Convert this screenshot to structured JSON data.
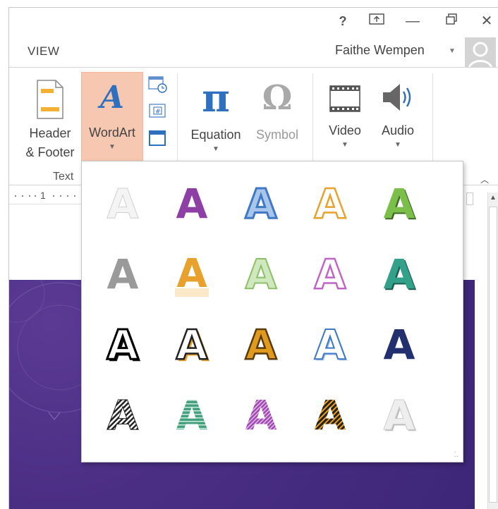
{
  "titlebar": {
    "help_label": "?",
    "minimize_label": "—",
    "close_label": "✕"
  },
  "tabs": {
    "view_label": "VIEW"
  },
  "user": {
    "name": "Faithe Wempen"
  },
  "ribbon": {
    "header_footer_line1": "Header",
    "header_footer_line2": "& Footer",
    "wordart_glyph": "A",
    "wordart_label": "WordArt",
    "equation_glyph": "π",
    "equation_label": "Equation",
    "symbol_glyph": "Ω",
    "symbol_label": "Symbol",
    "video_label": "Video",
    "audio_label": "Audio",
    "group_text": "Text"
  },
  "ruler": {
    "marker": "1"
  },
  "wordart_gallery": {
    "letter": "A",
    "styles": [
      [
        "#f2f2f2",
        "#8e3fa6",
        "#3f78c6",
        "#ffffff",
        "#63a33a"
      ],
      [
        "#9a9a9a",
        "#e7a12c",
        "#a8d08d",
        "#ffffff",
        "#2c8c7a"
      ],
      [
        "#ffffff",
        "#ffffff",
        "#e09a1e",
        "#ffffff",
        "#223070"
      ],
      [
        "#333333",
        "#46a07e",
        "#a04bb0",
        "#222222",
        "#e8e8e8"
      ]
    ]
  }
}
